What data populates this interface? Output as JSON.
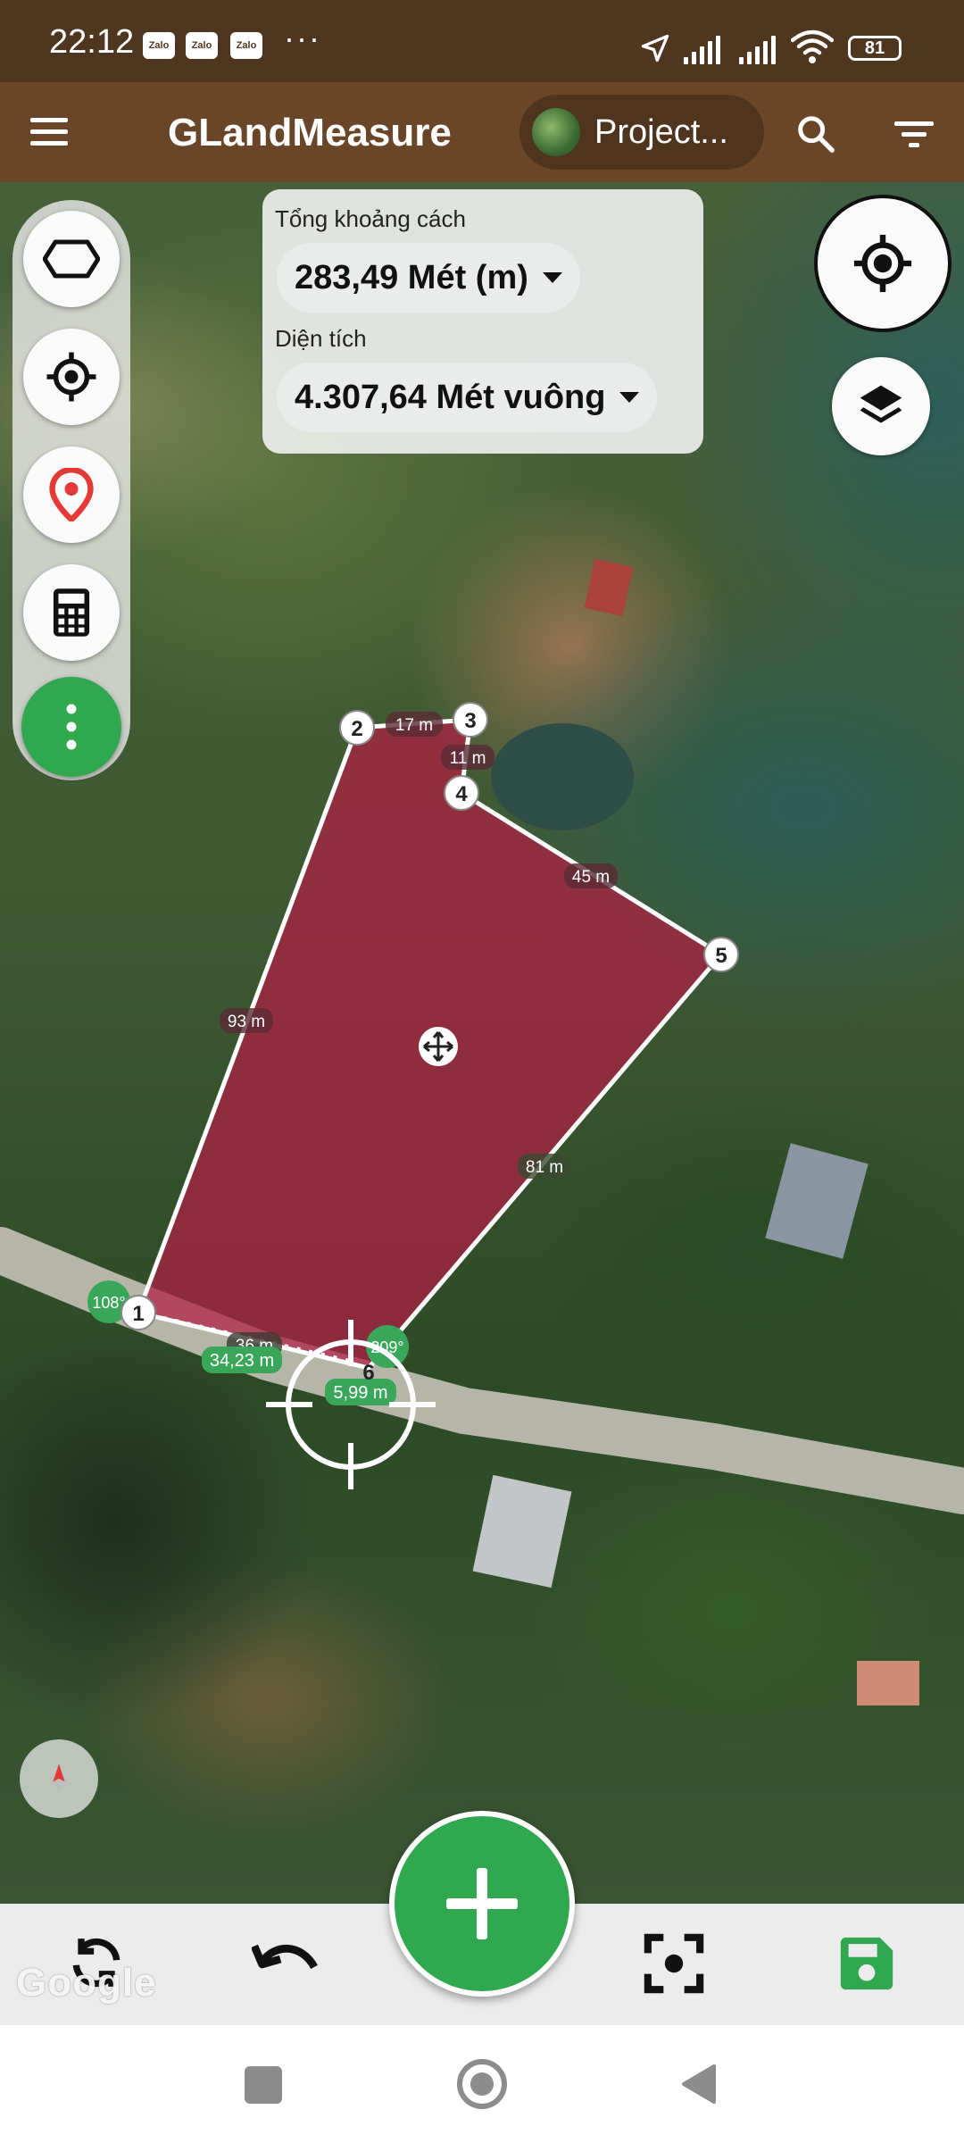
{
  "status_bar": {
    "time": "22:12",
    "notifications": [
      "Zalo",
      "Zalo",
      "Zalo"
    ],
    "more": "···",
    "battery": "81"
  },
  "app_bar": {
    "title": "GLandMeasure",
    "project_label": "Project..."
  },
  "measure_card": {
    "distance_label": "Tổng khoảng cách",
    "distance_value": "283,49 Mét (m)",
    "area_label": "Diện tích",
    "area_value": "4.307,64 Mét vuông"
  },
  "plot": {
    "fill_color": "#b01e44",
    "vertices": [
      "1",
      "2",
      "3",
      "4",
      "5",
      "6"
    ],
    "edge_lengths": [
      "17 m",
      "11 m",
      "45 m",
      "81 m",
      "93 m",
      "36 m"
    ],
    "angle_labels": [
      "108°",
      "209°"
    ],
    "cursor_distances": [
      "34,23 m",
      "5,99 m"
    ]
  },
  "map": {
    "attribution": "Google"
  },
  "icons": {
    "menu": "menu-icon",
    "search": "search-icon",
    "filter": "filter-icon",
    "polygon": "polygon-icon",
    "locate": "crosshair-icon",
    "pin": "location-pin-icon",
    "calculator": "calculator-icon",
    "more": "more-vertical-icon",
    "gps": "gps-icon",
    "layers": "layers-icon",
    "compass": "compass-icon",
    "refresh": "refresh-icon",
    "undo": "undo-icon",
    "focus": "focus-icon",
    "save": "save-icon",
    "add": "add-icon"
  },
  "colors": {
    "status_bar": "#4f361f",
    "app_bar": "#6a4629",
    "accent_green": "#2fa84f",
    "plot_fill": "#b01e44"
  }
}
